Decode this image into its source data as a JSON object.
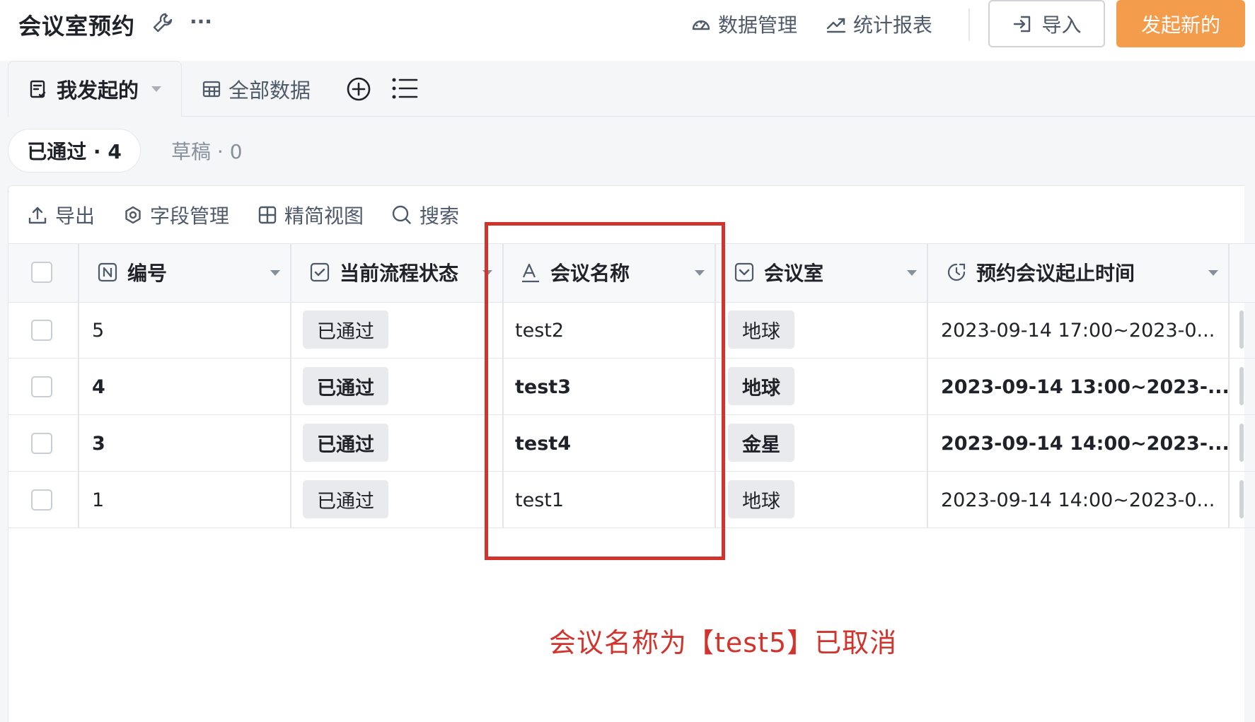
{
  "header": {
    "title": "会议室预约",
    "more_label": "···",
    "links": [
      "数据管理",
      "统计报表"
    ],
    "import_label": "导入",
    "new_label": "发起新的"
  },
  "tabs": [
    {
      "label": "我发起的",
      "active": true
    },
    {
      "label": "全部数据",
      "active": false
    }
  ],
  "status_chips": {
    "approved": "已通过 · 4",
    "draft": "草稿 · 0"
  },
  "toolbar": [
    "导出",
    "字段管理",
    "精简视图",
    "搜索"
  ],
  "table": {
    "columns": [
      "编号",
      "当前流程状态",
      "会议名称",
      "会议室",
      "预约会议起止时间"
    ],
    "rows": [
      {
        "id": "5",
        "status": "已通过",
        "name": "test2",
        "room": "地球",
        "time": "2023-09-14 17:00~2023-0...",
        "bold": false
      },
      {
        "id": "4",
        "status": "已通过",
        "name": "test3",
        "room": "地球",
        "time": "2023-09-14 13:00~2023-...",
        "bold": true
      },
      {
        "id": "3",
        "status": "已通过",
        "name": "test4",
        "room": "金星",
        "time": "2023-09-14 14:00~2023-...",
        "bold": true
      },
      {
        "id": "1",
        "status": "已通过",
        "name": "test1",
        "room": "地球",
        "time": "2023-09-14 14:00~2023-0...",
        "bold": false
      }
    ]
  },
  "annotation": "会议名称为【test5】已取消",
  "colors": {
    "accent": "#f39c4b",
    "annotation": "#d0342c",
    "tag_bg": "#e8eaed"
  }
}
